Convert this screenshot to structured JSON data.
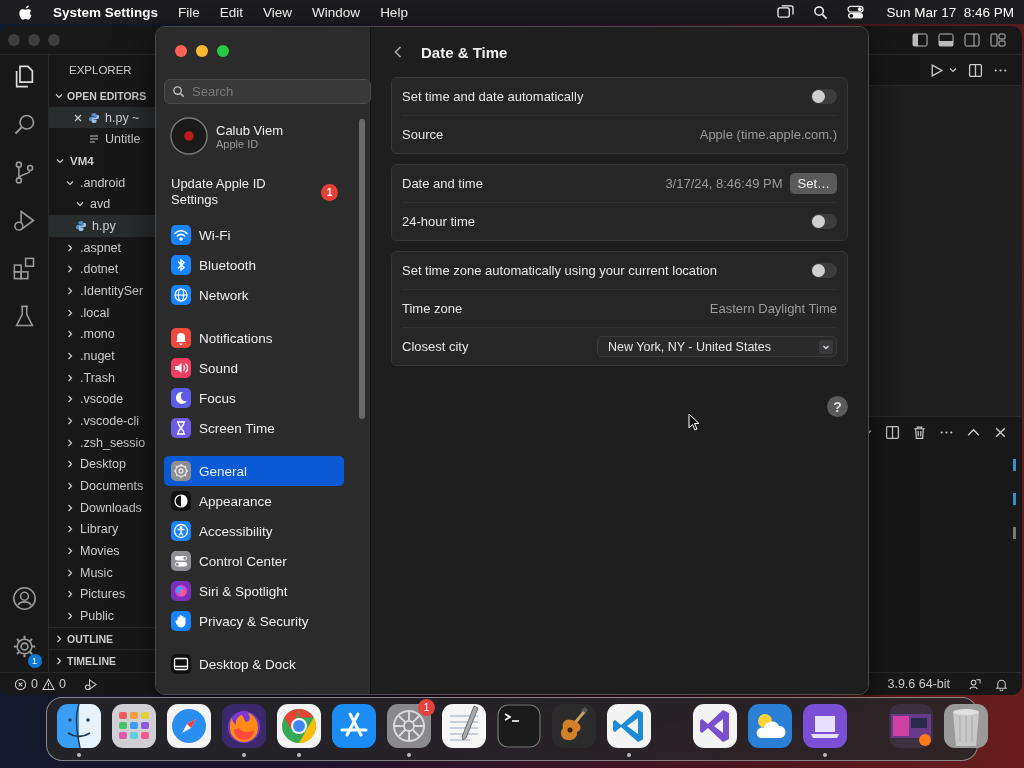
{
  "menu_bar": {
    "app_name": "System Settings",
    "menus": [
      "File",
      "Edit",
      "View",
      "Window",
      "Help"
    ],
    "clock": "Sun Mar 17  8:46 PM"
  },
  "code_editor": {
    "explorer_title": "EXPLORER",
    "open_editors": {
      "label": "OPEN EDITORS",
      "expanded": true,
      "files": [
        {
          "name": "h.py ~",
          "kind": "python",
          "selected": true
        },
        {
          "name": "Untitle",
          "kind": "text",
          "selected": false
        }
      ]
    },
    "tree": [
      {
        "name": "VM4",
        "kind": "root",
        "expanded": true,
        "selected": false,
        "children": [
          {
            "name": ".android",
            "kind": "folder",
            "expanded": true,
            "selected": false,
            "children": [
              {
                "name": "avd",
                "kind": "folder",
                "expanded": true,
                "selected": false
              },
              {
                "name": "h.py",
                "kind": "python",
                "selected": true
              }
            ]
          },
          {
            "name": ".aspnet",
            "kind": "folder",
            "expanded": false,
            "selected": false
          },
          {
            "name": ".dotnet",
            "kind": "folder",
            "expanded": false,
            "selected": false
          },
          {
            "name": ".IdentitySer",
            "kind": "folder",
            "expanded": false,
            "selected": false
          },
          {
            "name": ".local",
            "kind": "folder",
            "expanded": false,
            "selected": false
          },
          {
            "name": ".mono",
            "kind": "folder",
            "expanded": false,
            "selected": false
          },
          {
            "name": ".nuget",
            "kind": "folder",
            "expanded": false,
            "selected": false
          },
          {
            "name": ".Trash",
            "kind": "folder",
            "expanded": false,
            "selected": false
          },
          {
            "name": ".vscode",
            "kind": "folder",
            "expanded": false,
            "selected": false
          },
          {
            "name": ".vscode-cli",
            "kind": "folder",
            "expanded": false,
            "selected": false
          },
          {
            "name": ".zsh_sessio",
            "kind": "folder",
            "expanded": false,
            "selected": false
          },
          {
            "name": "Desktop",
            "kind": "folder",
            "expanded": false,
            "selected": false
          },
          {
            "name": "Documents",
            "kind": "folder",
            "expanded": false,
            "selected": false
          },
          {
            "name": "Downloads",
            "kind": "folder",
            "expanded": false,
            "selected": false
          },
          {
            "name": "Library",
            "kind": "folder",
            "expanded": false,
            "selected": false
          },
          {
            "name": "Movies",
            "kind": "folder",
            "expanded": false,
            "selected": false
          },
          {
            "name": "Music",
            "kind": "folder",
            "expanded": false,
            "selected": false
          },
          {
            "name": "Pictures",
            "kind": "folder",
            "expanded": false,
            "selected": false
          },
          {
            "name": "Public",
            "kind": "folder",
            "expanded": false,
            "selected": false
          }
        ]
      }
    ],
    "sections": [
      {
        "label": "OUTLINE",
        "expanded": false
      },
      {
        "label": "TIMELINE",
        "expanded": false
      }
    ],
    "settings_badge": "1",
    "status": {
      "errors": "0",
      "warnings": "0",
      "interpreter": "3.9.6 64-bit"
    }
  },
  "settings": {
    "search_placeholder": "Search",
    "account": {
      "name": "Calub Viem",
      "subtitle": "Apple ID"
    },
    "notice": {
      "text": "Update Apple ID Settings",
      "badge": "1"
    },
    "groups": [
      {
        "items": [
          {
            "label": "Wi-Fi",
            "kind": "wifi",
            "color": "#1a84ff",
            "selected": false
          },
          {
            "label": "Bluetooth",
            "kind": "bluetooth",
            "color": "#1a84ff",
            "selected": false
          },
          {
            "label": "Network",
            "kind": "globe",
            "color": "#1a84ff",
            "selected": false
          }
        ]
      },
      {
        "items": [
          {
            "label": "Notifications",
            "kind": "bell",
            "color": "#f0493e",
            "selected": false
          },
          {
            "label": "Sound",
            "kind": "speaker",
            "color": "#ee3f63",
            "selected": false
          },
          {
            "label": "Focus",
            "kind": "moon",
            "color": "#5e5ce6",
            "selected": false
          },
          {
            "label": "Screen Time",
            "kind": "hourglass",
            "color": "#6e5ce6",
            "selected": false
          }
        ]
      },
      {
        "items": [
          {
            "label": "General",
            "kind": "gear",
            "color": "#8e8e93",
            "selected": true
          },
          {
            "label": "Appearance",
            "kind": "contrast",
            "color": "#111111",
            "selected": false
          },
          {
            "label": "Accessibility",
            "kind": "figure",
            "color": "#1a84ff",
            "selected": false
          },
          {
            "label": "Control Center",
            "kind": "switches",
            "color": "#8e8e93",
            "selected": false
          },
          {
            "label": "Siri & Spotlight",
            "kind": "orb",
            "color": "#7a2fb8",
            "selected": false
          },
          {
            "label": "Privacy & Security",
            "kind": "hand",
            "color": "#1a84ff",
            "selected": false
          }
        ]
      },
      {
        "items": [
          {
            "label": "Desktop & Dock",
            "kind": "display",
            "color": "#111111",
            "selected": false
          }
        ]
      }
    ],
    "page": {
      "title": "Date & Time",
      "groups": [
        {
          "rows": [
            {
              "kind": "toggle",
              "label": "Set time and date automatically",
              "on": false
            },
            {
              "kind": "value",
              "label": "Source",
              "value": "Apple (time.apple.com.)"
            }
          ]
        },
        {
          "rows": [
            {
              "kind": "datetime",
              "label": "Date and time",
              "value": "3/17/24, 8:46:49 PM",
              "button": "Set…"
            },
            {
              "kind": "toggle",
              "label": "24-hour time",
              "on": false
            }
          ]
        },
        {
          "rows": [
            {
              "kind": "toggle",
              "label": "Set time zone automatically using your current location",
              "on": false
            },
            {
              "kind": "value",
              "label": "Time zone",
              "value": "Eastern Daylight Time"
            },
            {
              "kind": "select",
              "label": "Closest city",
              "value": "New York, NY - United States"
            }
          ]
        }
      ],
      "help": "?"
    }
  },
  "dock": {
    "groups": [
      {
        "apps": [
          {
            "kind": "finder",
            "color": "#3a9ef5",
            "running": true
          },
          {
            "kind": "launchpad",
            "color": "#cfcfd4",
            "running": false
          },
          {
            "kind": "safari",
            "color": "#f4f4f4",
            "running": false
          },
          {
            "kind": "firefox",
            "color": "#3b2a6b",
            "running": true
          },
          {
            "kind": "chrome",
            "color": "#f4f4f4",
            "running": true
          },
          {
            "kind": "appstore",
            "color": "#1c8cf5",
            "running": false
          },
          {
            "kind": "settings",
            "color": "#8a8a8e",
            "running": true,
            "badge": "1"
          },
          {
            "kind": "textedit",
            "color": "#f6f6f6",
            "running": false
          },
          {
            "kind": "terminal",
            "color": "#1b1b1b",
            "running": false
          },
          {
            "kind": "guitar",
            "color": "#2b2b2b",
            "running": false
          },
          {
            "kind": "vscode",
            "color": "#f4f4f4",
            "running": true
          }
        ]
      },
      {
        "apps": [
          {
            "kind": "visualstudio",
            "color": "#f4f4f4",
            "running": false
          },
          {
            "kind": "weather",
            "color": "#2a7fd6",
            "running": false
          },
          {
            "kind": "configurator",
            "color": "#7a4fd6",
            "running": true
          }
        ]
      },
      {
        "apps": [
          {
            "kind": "thumbnail",
            "color": "#3a3040",
            "running": false
          },
          {
            "kind": "trash",
            "color": "#9a9a9a",
            "running": false
          }
        ]
      }
    ]
  }
}
